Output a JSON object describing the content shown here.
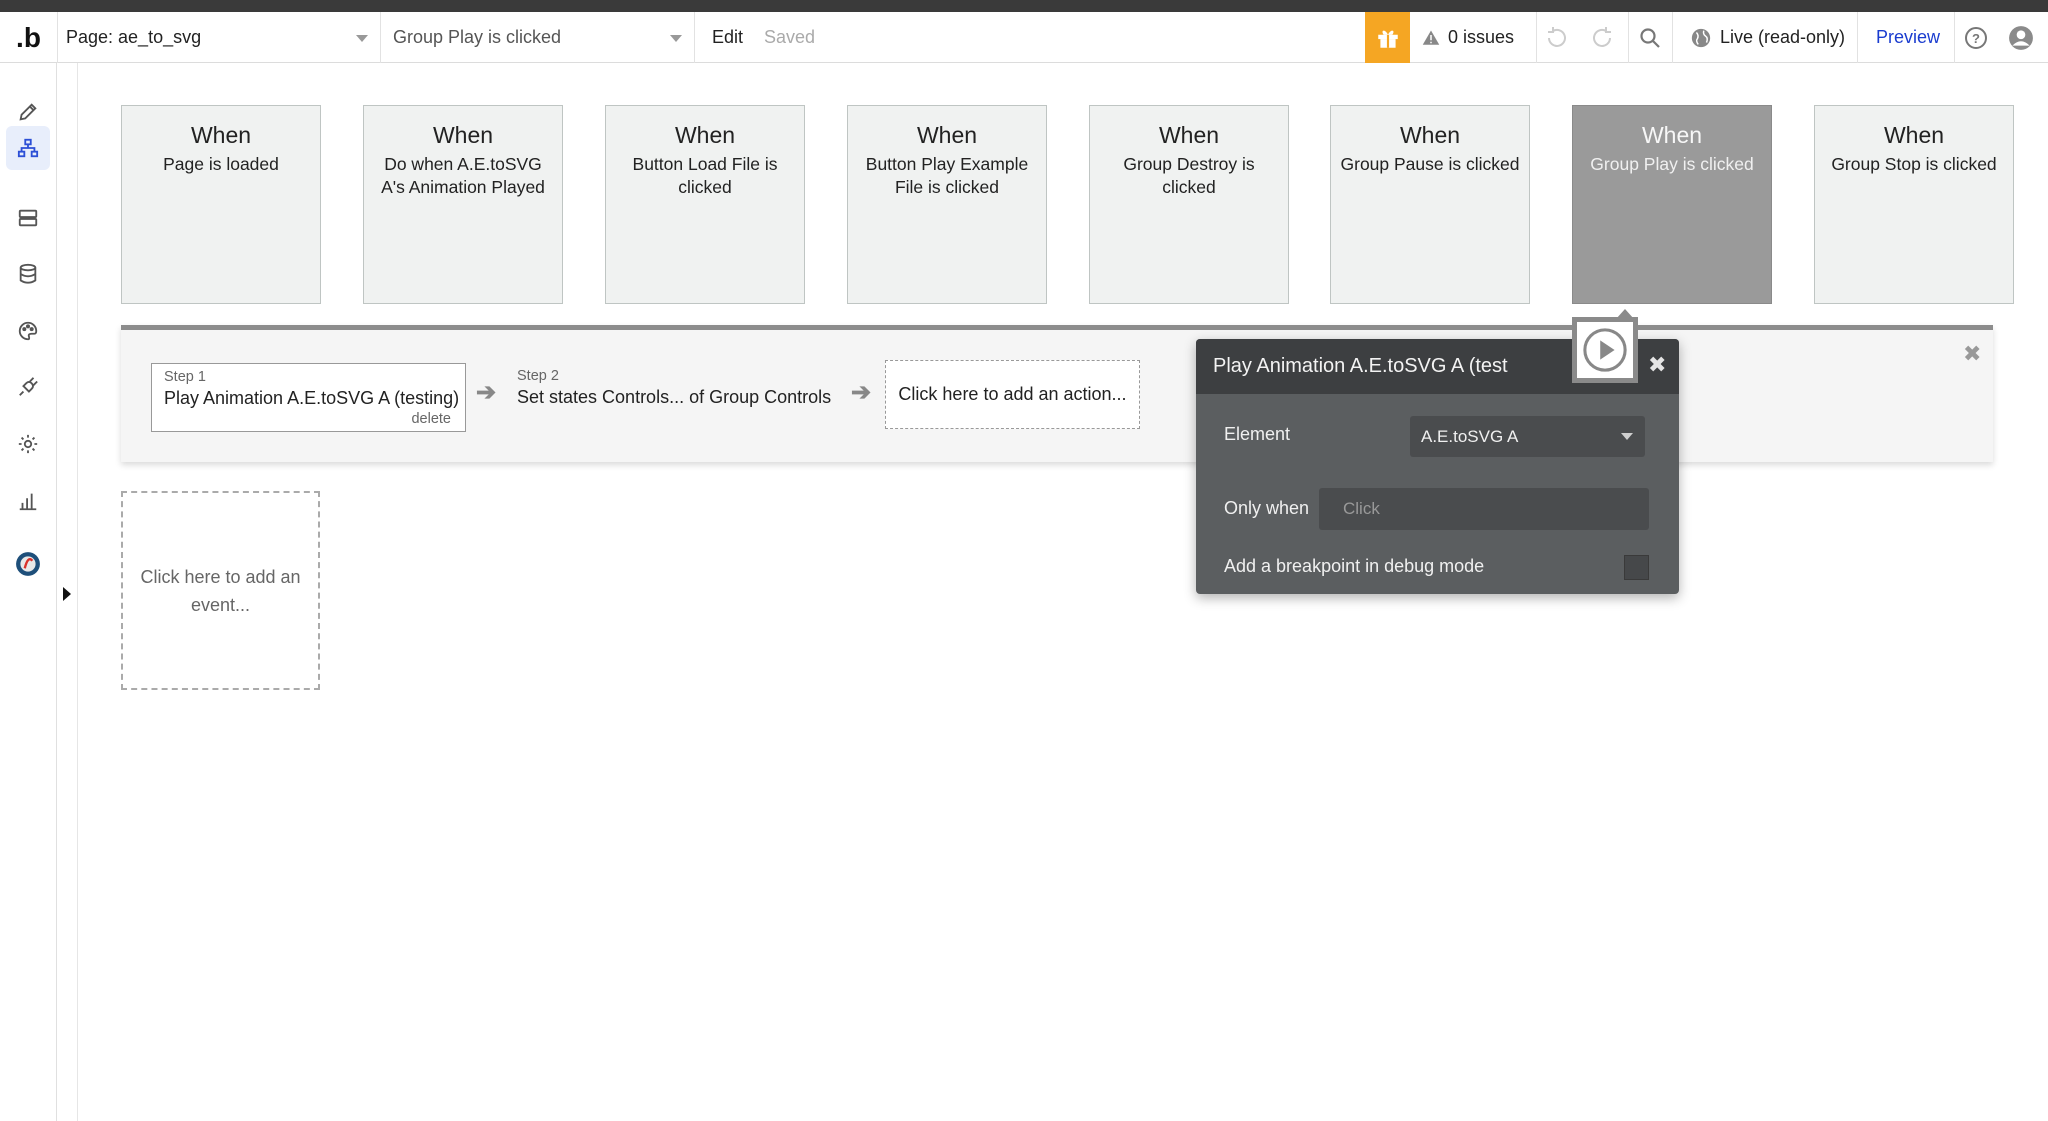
{
  "header": {
    "logo_text": ".b",
    "page_selector": "Page: ae_to_svg",
    "event_selector": "Group Play is clicked",
    "edit_label": "Edit",
    "saved_label": "Saved",
    "issues_label": "0 issues",
    "live_label": "Live (read-only)",
    "preview_label": "Preview",
    "accent_color": "#f5a623",
    "link_color": "#1a3ccf"
  },
  "sidebar": {
    "items": [
      {
        "icon": "pencil-icon",
        "label": "design"
      },
      {
        "icon": "workflow-icon",
        "label": "workflow",
        "active": true
      },
      {
        "icon": "data-icon",
        "label": "data"
      },
      {
        "icon": "database-icon",
        "label": "database"
      },
      {
        "icon": "palette-icon",
        "label": "styles"
      },
      {
        "icon": "plugin-icon",
        "label": "plugins"
      },
      {
        "icon": "gear-icon",
        "label": "settings"
      },
      {
        "icon": "chart-icon",
        "label": "logs"
      },
      {
        "icon": "app-avatar-icon",
        "label": "app"
      }
    ]
  },
  "events": [
    {
      "when": "When",
      "desc": "Page is loaded"
    },
    {
      "when": "When",
      "desc": "Do when A.E.toSVG A's Animation Played"
    },
    {
      "when": "When",
      "desc": "Button Load File is clicked"
    },
    {
      "when": "When",
      "desc": "Button Play Example File is clicked"
    },
    {
      "when": "When",
      "desc": "Group Destroy is clicked"
    },
    {
      "when": "When",
      "desc": "Group Pause is clicked"
    },
    {
      "when": "When",
      "desc": "Group Play is clicked",
      "selected": true
    },
    {
      "when": "When",
      "desc": "Group Stop is clicked"
    }
  ],
  "add_event": "Click here to add an event...",
  "workflow": {
    "steps": [
      {
        "number": "Step 1",
        "title": "Play Animation A.E.toSVG A (testing)",
        "delete": "delete"
      },
      {
        "number": "Step 2",
        "title": "Set states Controls... of Group Controls"
      }
    ],
    "add_action": "Click here to add an action..."
  },
  "panel": {
    "title": "Play Animation A.E.toSVG A (test",
    "element_label": "Element",
    "element_value": "A.E.toSVG A",
    "only_when_label": "Only when",
    "only_when_placeholder": "Click",
    "breakpoint_label": "Add a breakpoint in debug mode"
  }
}
